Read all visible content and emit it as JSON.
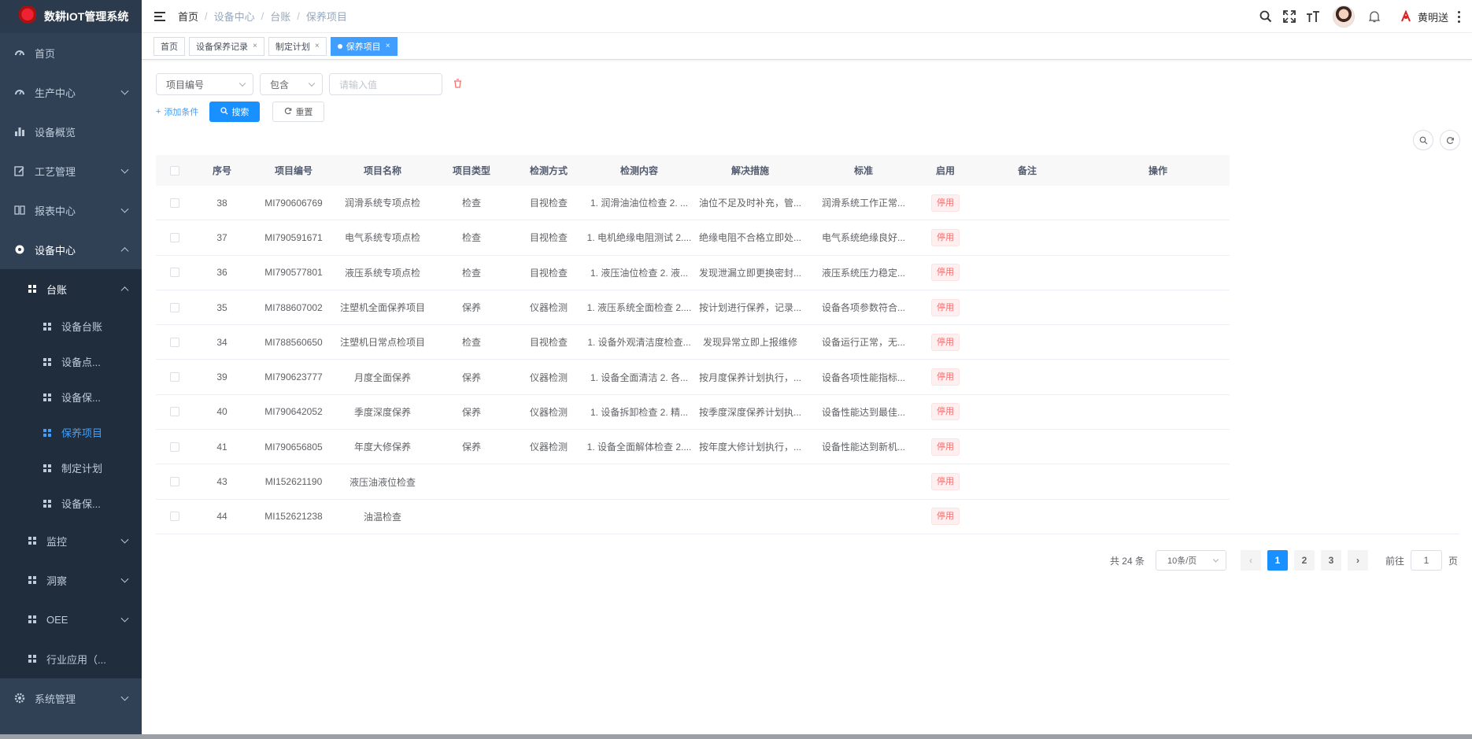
{
  "app": {
    "title": "数耕IOT管理系统"
  },
  "sidebar": {
    "home": "首页",
    "production": "生产中心",
    "overview": "设备概览",
    "process": "工艺管理",
    "reports": "报表中心",
    "equipment": "设备中心",
    "ledger": "台账",
    "ledger_items": [
      "设备台账",
      "设备点...",
      "设备保...",
      "保养项目",
      "制定计划",
      "设备保..."
    ],
    "monitor": "监控",
    "insight": "洞察",
    "oee": "OEE",
    "industry": "行业应用（...",
    "system": "系统管理"
  },
  "breadcrumb": [
    "首页",
    "设备中心",
    "台账",
    "保养项目"
  ],
  "header": {
    "username": "黄明送"
  },
  "tags": [
    {
      "label": "首页"
    },
    {
      "label": "设备保养记录"
    },
    {
      "label": "制定计划"
    },
    {
      "label": "保养项目"
    }
  ],
  "search": {
    "field_select": "项目编号",
    "op_select": "包含",
    "value_placeholder": "请输入值",
    "add_condition": "添加条件",
    "search_btn": "搜索",
    "reset_btn": "重置"
  },
  "table": {
    "headers": [
      "序号",
      "项目编号",
      "项目名称",
      "项目类型",
      "检测方式",
      "检测内容",
      "解决措施",
      "标准",
      "启用",
      "备注",
      "操作"
    ],
    "rows": [
      {
        "no": "38",
        "code": "MI790606769",
        "name": "润滑系统专项点检",
        "type": "检查",
        "method": "目视检查",
        "content": "1. 润滑油油位检查 2. ...",
        "measure": "油位不足及时补充，管...",
        "standard": "润滑系统工作正常...",
        "status": "停用"
      },
      {
        "no": "37",
        "code": "MI790591671",
        "name": "电气系统专项点检",
        "type": "检查",
        "method": "目视检查",
        "content": "1. 电机绝缘电阻测试 2....",
        "measure": "绝缘电阻不合格立即处...",
        "standard": "电气系统绝缘良好...",
        "status": "停用"
      },
      {
        "no": "36",
        "code": "MI790577801",
        "name": "液压系统专项点检",
        "type": "检查",
        "method": "目视检查",
        "content": "1. 液压油位检查 2. 液...",
        "measure": "发现泄漏立即更换密封...",
        "standard": "液压系统压力稳定...",
        "status": "停用"
      },
      {
        "no": "35",
        "code": "MI788607002",
        "name": "注塑机全面保养项目",
        "type": "保养",
        "method": "仪器检测",
        "content": "1. 液压系统全面检查 2....",
        "measure": "按计划进行保养，记录...",
        "standard": "设备各项参数符合...",
        "status": "停用"
      },
      {
        "no": "34",
        "code": "MI788560650",
        "name": "注塑机日常点检项目",
        "type": "检查",
        "method": "目视检查",
        "content": "1. 设备外观清洁度检查...",
        "measure": "发现异常立即上报维修",
        "standard": "设备运行正常，无...",
        "status": "停用"
      },
      {
        "no": "39",
        "code": "MI790623777",
        "name": "月度全面保养",
        "type": "保养",
        "method": "仪器检测",
        "content": "1. 设备全面清洁 2. 各...",
        "measure": "按月度保养计划执行，...",
        "standard": "设备各项性能指标...",
        "status": "停用"
      },
      {
        "no": "40",
        "code": "MI790642052",
        "name": "季度深度保养",
        "type": "保养",
        "method": "仪器检测",
        "content": "1. 设备拆卸检查 2. 精...",
        "measure": "按季度深度保养计划执...",
        "standard": "设备性能达到最佳...",
        "status": "停用"
      },
      {
        "no": "41",
        "code": "MI790656805",
        "name": "年度大修保养",
        "type": "保养",
        "method": "仪器检测",
        "content": "1. 设备全面解体检查 2....",
        "measure": "按年度大修计划执行，...",
        "standard": "设备性能达到新机...",
        "status": "停用"
      },
      {
        "no": "43",
        "code": "MI152621190",
        "name": "液压油液位检查",
        "type": "",
        "method": "",
        "content": "",
        "measure": "",
        "standard": "",
        "status": "停用"
      },
      {
        "no": "44",
        "code": "MI152621238",
        "name": "油温检查",
        "type": "",
        "method": "",
        "content": "",
        "measure": "",
        "standard": "",
        "status": "停用"
      }
    ]
  },
  "pagination": {
    "total_text": "共 24 条",
    "page_size": "10条/页",
    "pages": [
      "1",
      "2",
      "3"
    ],
    "current": "1",
    "goto_prefix": "前往",
    "goto_value": "1",
    "goto_suffix": "页"
  }
}
